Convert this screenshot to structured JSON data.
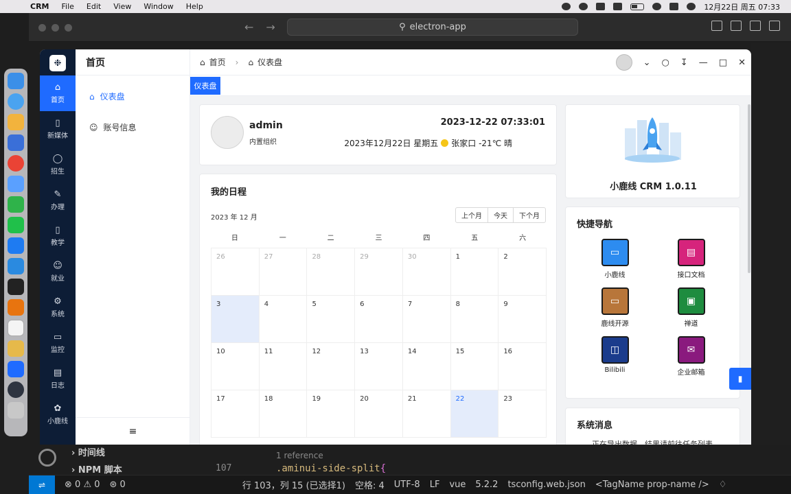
{
  "menubar": {
    "app_name": "CRM",
    "menus": [
      "File",
      "Edit",
      "View",
      "Window",
      "Help"
    ],
    "clock": "12月22日 周五 07:33"
  },
  "vscode": {
    "search_label": "electron-app",
    "tree": [
      "时间线",
      "NPM 脚本"
    ],
    "code_reference": "1 reference",
    "line_number": "107",
    "code_line": ".aminui-side-split",
    "code_brace": "{",
    "status": {
      "errors": "0",
      "warnings": "0",
      "ports": "0",
      "position": "行 103，列 15 (已选择1)",
      "spaces": "空格: 4",
      "encoding": "UTF-8",
      "eol": "LF",
      "language": "vue",
      "version": "5.2.2",
      "config": "tsconfig.web.json",
      "snippet": "<TagName prop-name />"
    }
  },
  "rail": {
    "items": [
      {
        "label": "首页",
        "icon": "home-icon"
      },
      {
        "label": "新媒体",
        "icon": "mobile-icon"
      },
      {
        "label": "招生",
        "icon": "headset-icon"
      },
      {
        "label": "办理",
        "icon": "edit-icon"
      },
      {
        "label": "教学",
        "icon": "phone-icon"
      },
      {
        "label": "就业",
        "icon": "user-icon"
      },
      {
        "label": "系统",
        "icon": "gear-icon"
      },
      {
        "label": "监控",
        "icon": "monitor-icon"
      },
      {
        "label": "日志",
        "icon": "log-icon"
      },
      {
        "label": "小鹿线",
        "icon": "bug-icon"
      }
    ]
  },
  "submenu": {
    "title": "首页",
    "items": [
      {
        "label": "仪表盘",
        "icon": "home-icon"
      },
      {
        "label": "账号信息",
        "icon": "user-icon"
      }
    ]
  },
  "topbar": {
    "breadcrumb": [
      "首页",
      "仪表盘"
    ]
  },
  "tags": [
    "仪表盘"
  ],
  "user": {
    "name": "admin",
    "org": "内置组织",
    "datetime": "2023-12-22 07:33:01",
    "date_text": "2023年12月22日 星期五",
    "weather": "张家口 -21℃ 晴"
  },
  "schedule": {
    "title": "我的日程",
    "month": "2023 年 12 月",
    "buttons": [
      "上个月",
      "今天",
      "下个月"
    ],
    "weekdays": [
      "日",
      "一",
      "二",
      "三",
      "四",
      "五",
      "六"
    ],
    "weeks": [
      [
        "26",
        "27",
        "28",
        "29",
        "30",
        "1",
        "2"
      ],
      [
        "3",
        "4",
        "5",
        "6",
        "7",
        "8",
        "9"
      ],
      [
        "10",
        "11",
        "12",
        "13",
        "14",
        "15",
        "16"
      ],
      [
        "17",
        "18",
        "19",
        "20",
        "21",
        "22",
        "23"
      ]
    ]
  },
  "version": {
    "label": "小鹿线 CRM 1.0.11"
  },
  "quick_nav": {
    "title": "快捷导航",
    "items": [
      {
        "label": "小鹿线",
        "color": "#2d8cf0",
        "icon": "monitor-icon"
      },
      {
        "label": "接口文档",
        "color": "#d6247c",
        "icon": "document-icon"
      },
      {
        "label": "鹿线开源",
        "color": "#b8763a",
        "icon": "book-icon"
      },
      {
        "label": "禅道",
        "color": "#1e8c3f",
        "icon": "zentao-icon"
      },
      {
        "label": "Bilibili",
        "color": "#1b3c8c",
        "icon": "tv-icon"
      },
      {
        "label": "企业邮箱",
        "color": "#8a1a7e",
        "icon": "mail-icon"
      }
    ]
  },
  "messages": {
    "title": "系统消息",
    "first": "正在导出数据，结果请前往任务列表"
  },
  "colors": {
    "accent": "#1f6bff",
    "rail_bg": "#0d1d36"
  }
}
